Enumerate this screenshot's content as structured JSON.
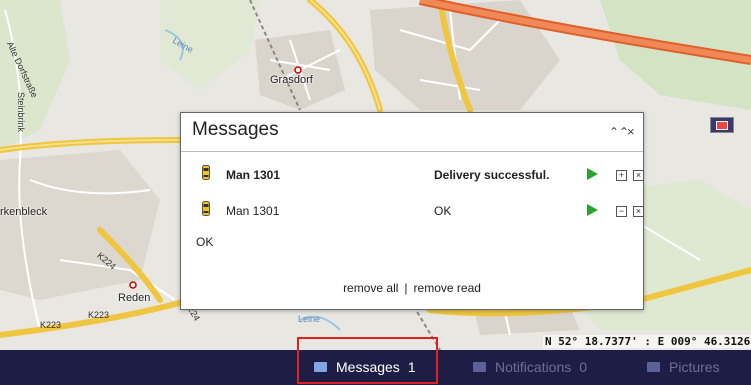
{
  "map": {
    "places": [
      "Grasdorf",
      "rkenbleck",
      "Reden"
    ],
    "streets": [
      "Alte Dorfstraße",
      "Steinbrink",
      "Leine",
      "Leine"
    ],
    "roads": [
      "K224",
      "K223",
      "K223",
      "K224"
    ],
    "coordinates": "N 52° 18.7377' : E 009° 46.3126"
  },
  "dialog": {
    "title": "Messages",
    "collapse_icon": "double-chevron-up",
    "close_icon": "close-x",
    "messages": [
      {
        "sender": "Man 1301",
        "text": "Delivery successful.",
        "unread": true,
        "expand_symbol": "⊞",
        "remove_symbol": "⊠"
      },
      {
        "sender": "Man 1301",
        "text": "OK",
        "unread": false,
        "expand_symbol": "⊟",
        "remove_symbol": "⊠"
      }
    ],
    "detail_text": "OK",
    "remove_all": "remove all",
    "separator": "|",
    "remove_read": "remove read"
  },
  "bar": {
    "tabs": [
      {
        "label": "Messages",
        "count": "1",
        "active": true
      },
      {
        "label": "Notifications",
        "count": "0",
        "active": false
      },
      {
        "label": "Pictures",
        "count": "",
        "active": false
      }
    ]
  },
  "colors": {
    "bar_bg": "#1e1d45",
    "highlight": "#e02020",
    "play": "#2aa52a",
    "road_major": "#f0c640",
    "motorway": "#f07040"
  }
}
